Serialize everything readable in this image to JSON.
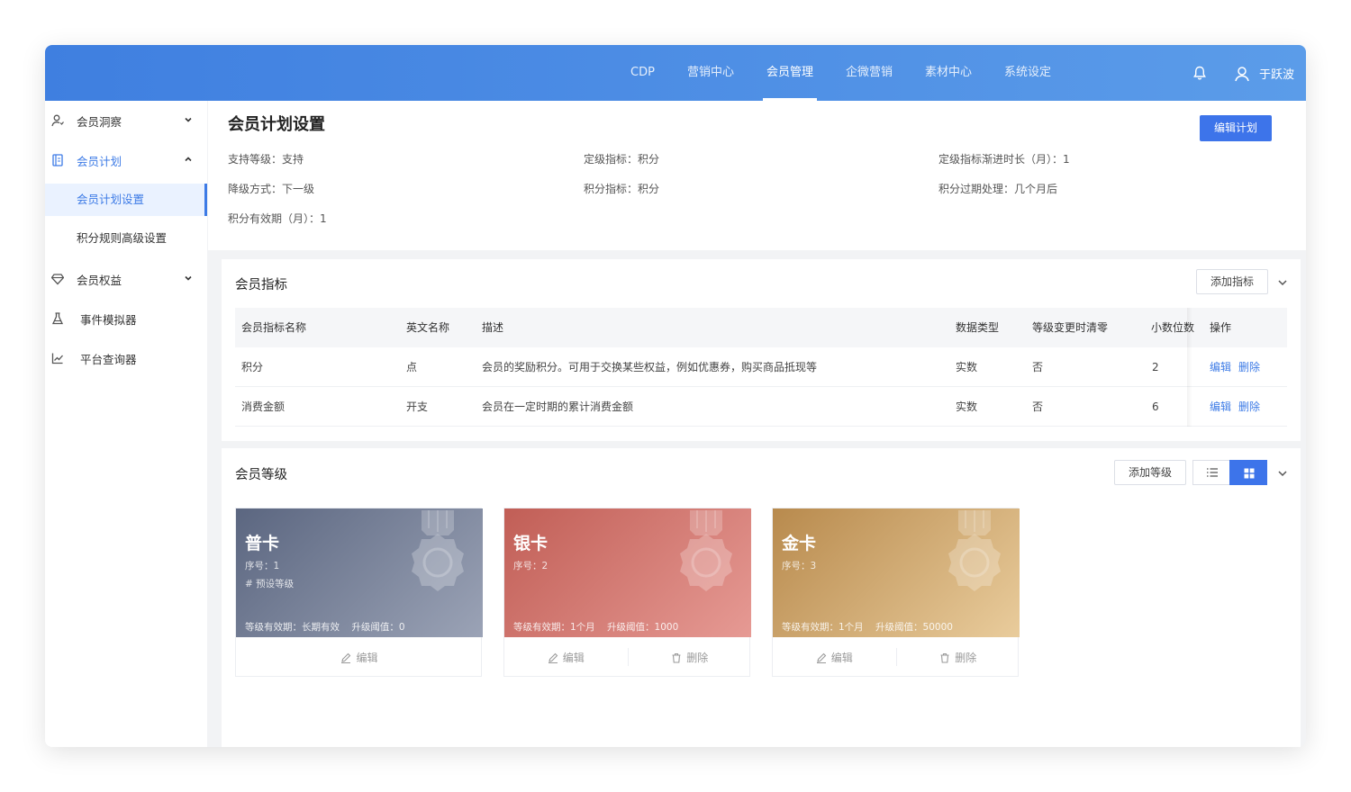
{
  "topbar": {
    "nav": [
      "CDP",
      "营销中心",
      "会员管理",
      "企微营销",
      "素材中心",
      "系统设定"
    ],
    "active_index": 2,
    "user_name": "于跃波",
    "bell_icon": "bell-icon",
    "user_icon": "user-icon"
  },
  "sidebar": {
    "items": [
      {
        "label": "会员洞察",
        "icon": "person-icon",
        "chevron": "down"
      },
      {
        "label": "会员计划",
        "icon": "document-icon",
        "chevron": "up"
      },
      {
        "label": "会员权益",
        "icon": "diamond-icon",
        "chevron": "down"
      },
      {
        "label": "事件模拟器",
        "icon": "flask-icon"
      },
      {
        "label": "平台查询器",
        "icon": "chart-line-icon"
      }
    ],
    "sub_items": [
      "会员计划设置",
      "积分规则高级设置"
    ]
  },
  "header": {
    "title": "会员计划设置",
    "edit_button": "编辑计划",
    "info": {
      "support_level": "支持等级：支持",
      "grade_metric": "定级指标：积分",
      "grade_window": "定级指标渐进时长（月）：1",
      "downgrade": "降级方式：下一级",
      "points_metric": "积分指标：积分",
      "points_expiry": "积分过期处理：几个月后",
      "points_validity": "积分有效期（月）：1"
    }
  },
  "metrics": {
    "title": "会员指标",
    "add_button": "添加指标",
    "columns": [
      "会员指标名称",
      "英文名称",
      "描述",
      "数据类型",
      "等级变更时清零",
      "小数位数",
      "操作"
    ],
    "rows": [
      [
        "积分",
        "点",
        "会员的奖励积分。可用于交换某些权益，例如优惠券，购买商品抵现等",
        "实数",
        "否",
        "2"
      ],
      [
        "消费金额",
        "开支",
        "会员在一定时期的累计消费金额",
        "实数",
        "否",
        "6"
      ]
    ],
    "edit_link": "编辑",
    "delete_link": "删除"
  },
  "levels": {
    "title": "会员等级",
    "add_button": "添加等级",
    "cards": [
      {
        "name": "普卡",
        "seq": "序号：1",
        "tag": "# 预设等级",
        "validity": "等级有效期：长期有效",
        "threshold": "升级阈值：0",
        "color_a": "#5b6680",
        "color_b": "#9ba3b6"
      },
      {
        "name": "银卡",
        "seq": "序号：2",
        "tag": "",
        "validity": "等级有效期：1个月",
        "threshold": "升级阈值：1000",
        "color_a": "#c15e56",
        "color_b": "#e69a94"
      },
      {
        "name": "金卡",
        "seq": "序号：3",
        "tag": "",
        "validity": "等级有效期：1个月",
        "threshold": "升级阈值：50000",
        "color_a": "#b88a4d",
        "color_b": "#e9cc9c"
      }
    ],
    "edit_label": "编辑",
    "delete_label": "删除"
  },
  "colors": {
    "accent": "#3d74ea",
    "topbar_start": "#3f7fe0",
    "topbar_end": "#5b9ce9",
    "page_bg": "#f2f3f5"
  }
}
